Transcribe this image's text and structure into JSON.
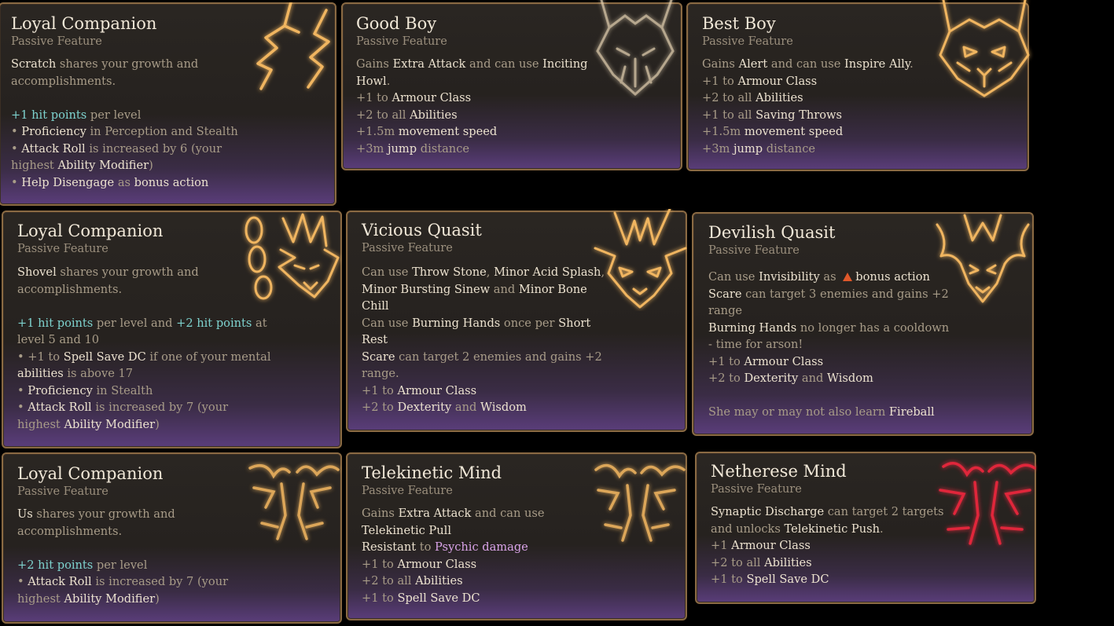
{
  "cards": [
    {
      "title": "Loyal Companion",
      "subtitle": "Passive Feature",
      "art": "lightning-icon",
      "lines": [
        [
          {
            "t": "Scratch",
            "c": "hl"
          },
          {
            "t": " shares your growth and"
          }
        ],
        [
          {
            "t": "accomplishments."
          }
        ],
        [],
        [
          {
            "t": "+1 hit points",
            "c": "hp"
          },
          {
            "t": " per level"
          }
        ],
        [
          {
            "t": "• "
          },
          {
            "t": "Proficiency",
            "c": "hl"
          },
          {
            "t": " in Perception and Stealth"
          }
        ],
        [
          {
            "t": "• "
          },
          {
            "t": "Attack Roll",
            "c": "hl"
          },
          {
            "t": " is increased by 6 (your"
          }
        ],
        [
          {
            "t": "highest "
          },
          {
            "t": "Ability Modifier",
            "c": "hl"
          },
          {
            "t": ")"
          }
        ],
        [
          {
            "t": "• "
          },
          {
            "t": "Help Disengage",
            "c": "hl"
          },
          {
            "t": " as "
          },
          {
            "t": "bonus action",
            "c": "hl"
          }
        ]
      ]
    },
    {
      "title": "Good Boy",
      "subtitle": "Passive Feature",
      "art": "wolf-head-icon",
      "lines": [
        [
          {
            "t": "Gains "
          },
          {
            "t": "Extra Attack",
            "c": "hl"
          },
          {
            "t": " and can use "
          },
          {
            "t": "Inciting",
            "c": "hl"
          }
        ],
        [
          {
            "t": "Howl",
            "c": "hl"
          },
          {
            "t": "."
          }
        ],
        [
          {
            "t": "+1 to "
          },
          {
            "t": "Armour Class",
            "c": "hl"
          }
        ],
        [
          {
            "t": "+2 to all "
          },
          {
            "t": "Abilities",
            "c": "hl"
          }
        ],
        [
          {
            "t": "+1.5m "
          },
          {
            "t": "movement speed",
            "c": "hl"
          }
        ],
        [
          {
            "t": "+3m "
          },
          {
            "t": "jump",
            "c": "hl"
          },
          {
            "t": " distance"
          }
        ]
      ]
    },
    {
      "title": "Best Boy",
      "subtitle": "Passive Feature",
      "art": "wolf-head-icon",
      "lines": [
        [
          {
            "t": "Gains "
          },
          {
            "t": "Alert",
            "c": "hl"
          },
          {
            "t": " and can use "
          },
          {
            "t": "Inspire Ally",
            "c": "hl"
          },
          {
            "t": "."
          }
        ],
        [
          {
            "t": "+1 to "
          },
          {
            "t": "Armour Class",
            "c": "hl"
          }
        ],
        [
          {
            "t": "+2 to all "
          },
          {
            "t": "Abilities",
            "c": "hl"
          }
        ],
        [
          {
            "t": "+1 to all "
          },
          {
            "t": "Saving Throws",
            "c": "hl"
          }
        ],
        [
          {
            "t": "+1.5m "
          },
          {
            "t": "movement speed",
            "c": "hl"
          }
        ],
        [
          {
            "t": "+3m "
          },
          {
            "t": "jump",
            "c": "hl"
          },
          {
            "t": " distance"
          }
        ]
      ]
    },
    {
      "title": "Loyal Companion",
      "subtitle": "Passive Feature",
      "art": "chained-imp-icon",
      "lines": [
        [
          {
            "t": "Shovel",
            "c": "hl"
          },
          {
            "t": " shares your growth and"
          }
        ],
        [
          {
            "t": "accomplishments."
          }
        ],
        [],
        [
          {
            "t": "+1 hit points",
            "c": "hp"
          },
          {
            "t": " per level and "
          },
          {
            "t": "+2 hit points",
            "c": "hp"
          },
          {
            "t": " at"
          }
        ],
        [
          {
            "t": "level 5 and 10"
          }
        ],
        [
          {
            "t": "• +1 to "
          },
          {
            "t": "Spell Save DC",
            "c": "hl"
          },
          {
            "t": " if one of your mental"
          }
        ],
        [
          {
            "t": "abilities",
            "c": "hl"
          },
          {
            "t": " is above 17"
          }
        ],
        [
          {
            "t": "• "
          },
          {
            "t": "Proficiency",
            "c": "hl"
          },
          {
            "t": " in Stealth"
          }
        ],
        [
          {
            "t": "• "
          },
          {
            "t": "Attack Roll",
            "c": "hl"
          },
          {
            "t": " is increased by 7 (your"
          }
        ],
        [
          {
            "t": "highest "
          },
          {
            "t": "Ability Modifier",
            "c": "hl"
          },
          {
            "t": ")"
          }
        ]
      ]
    },
    {
      "title": "Vicious Quasit",
      "subtitle": "Passive Feature",
      "art": "imp-head-icon",
      "lines": [
        [
          {
            "t": "Can use "
          },
          {
            "t": "Throw Stone",
            "c": "hl"
          },
          {
            "t": ", "
          },
          {
            "t": "Minor Acid Splash",
            "c": "hl"
          },
          {
            "t": ","
          }
        ],
        [
          {
            "t": "Minor Bursting Sinew",
            "c": "hl"
          },
          {
            "t": " and "
          },
          {
            "t": "Minor Bone",
            "c": "hl"
          }
        ],
        [
          {
            "t": "Chill",
            "c": "hl"
          }
        ],
        [
          {
            "t": "Can use "
          },
          {
            "t": "Burning Hands",
            "c": "hl"
          },
          {
            "t": " once per "
          },
          {
            "t": "Short",
            "c": "hl"
          }
        ],
        [
          {
            "t": "Rest",
            "c": "hl"
          }
        ],
        [
          {
            "t": "Scare",
            "c": "hl"
          },
          {
            "t": " can target 2 enemies and gains +2"
          }
        ],
        [
          {
            "t": "range."
          }
        ],
        [
          {
            "t": "+1 to "
          },
          {
            "t": "Armour Class",
            "c": "hl"
          }
        ],
        [
          {
            "t": "+2 to "
          },
          {
            "t": "Dexterity",
            "c": "hl"
          },
          {
            "t": " and "
          },
          {
            "t": "Wisdom",
            "c": "hl"
          }
        ]
      ]
    },
    {
      "title": "Devilish Quasit",
      "subtitle": "Passive Feature",
      "art": "devil-head-icon",
      "lines": [
        [
          {
            "t": "Can use "
          },
          {
            "t": "Invisibility",
            "c": "hl"
          },
          {
            "t": " as "
          },
          {
            "icon": "fire"
          },
          {
            "t": "bonus action",
            "c": "hl"
          }
        ],
        [
          {
            "t": "Scare",
            "c": "hl"
          },
          {
            "t": " can target 3 enemies and gains +2"
          }
        ],
        [
          {
            "t": "range"
          }
        ],
        [
          {
            "t": "Burning Hands",
            "c": "hl"
          },
          {
            "t": " no longer has a cooldown"
          }
        ],
        [
          {
            "t": "- time for arson!"
          }
        ],
        [
          {
            "t": "+1 to "
          },
          {
            "t": "Armour Class",
            "c": "hl"
          }
        ],
        [
          {
            "t": "+2 to "
          },
          {
            "t": "Dexterity",
            "c": "hl"
          },
          {
            "t": " and "
          },
          {
            "t": "Wisdom",
            "c": "hl"
          }
        ],
        [],
        [
          {
            "t": "She may or may not also learn "
          },
          {
            "t": "Fireball",
            "c": "hl"
          }
        ]
      ]
    },
    {
      "title": "Loyal Companion",
      "subtitle": "Passive Feature",
      "art": "brain-icon",
      "lines": [
        [
          {
            "t": "Us",
            "c": "hl"
          },
          {
            "t": " shares your growth and"
          }
        ],
        [
          {
            "t": "accomplishments."
          }
        ],
        [],
        [
          {
            "t": "+2 hit points",
            "c": "hp"
          },
          {
            "t": " per level"
          }
        ],
        [
          {
            "t": "• "
          },
          {
            "t": "Attack Roll",
            "c": "hl"
          },
          {
            "t": " is increased by 7 (your"
          }
        ],
        [
          {
            "t": "highest "
          },
          {
            "t": "Ability Modifier",
            "c": "hl"
          },
          {
            "t": ")"
          }
        ]
      ]
    },
    {
      "title": "Telekinetic Mind",
      "subtitle": "Passive Feature",
      "art": "brain-icon",
      "lines": [
        [
          {
            "t": "Gains "
          },
          {
            "t": "Extra Attack",
            "c": "hl"
          },
          {
            "t": " and can use"
          }
        ],
        [
          {
            "t": "Telekinetic Pull",
            "c": "hl"
          }
        ],
        [
          {
            "t": "Resistant",
            "c": "hl"
          },
          {
            "t": " to "
          },
          {
            "t": "Psychic damage",
            "c": "psy"
          }
        ],
        [
          {
            "t": "+1 to "
          },
          {
            "t": "Armour Class",
            "c": "hl"
          }
        ],
        [
          {
            "t": "+2 to all "
          },
          {
            "t": "Abilities",
            "c": "hl"
          }
        ],
        [
          {
            "t": "+1 to "
          },
          {
            "t": "Spell Save DC",
            "c": "hl"
          }
        ]
      ]
    },
    {
      "title": "Netherese Mind",
      "subtitle": "Passive Feature",
      "art": "red-brain-icon",
      "lines": [
        [
          {
            "t": "Synaptic Discharge",
            "c": "hl"
          },
          {
            "t": " can target 2 targets"
          }
        ],
        [
          {
            "t": "and unlocks "
          },
          {
            "t": "Telekinetic Push",
            "c": "hl"
          },
          {
            "t": "."
          }
        ],
        [
          {
            "t": "+1 "
          },
          {
            "t": "Armour Class",
            "c": "hl"
          }
        ],
        [
          {
            "t": "+2 to all "
          },
          {
            "t": "Abilities",
            "c": "hl"
          }
        ],
        [
          {
            "t": "+1 to "
          },
          {
            "t": "Spell Save DC",
            "c": "hl"
          }
        ]
      ]
    }
  ],
  "colors": {
    "gold": "#f0b560",
    "red": "#e0283a",
    "highlight": "#ece2cf",
    "hitpoints": "#7ed3cf",
    "psychic": "#d9a3e8",
    "border": "#8a6a43"
  }
}
